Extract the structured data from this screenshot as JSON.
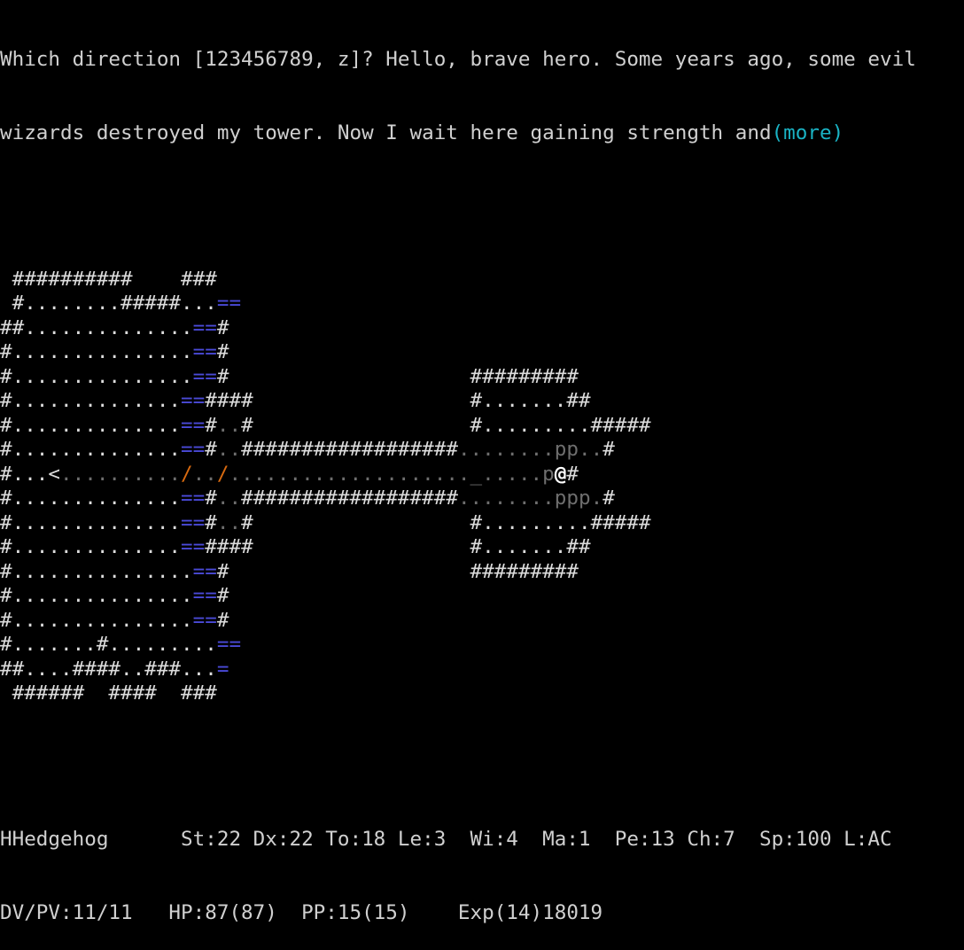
{
  "message": {
    "line1": "Which direction [123456789, z]? Hello, brave hero. Some years ago, some evil",
    "line2": "wizards destroyed my tower. Now I wait here gaining strength and",
    "more": "(more)"
  },
  "map": {
    "legend_colors": {
      "wall": "#dcdcdc",
      "floor_lit": "#dcdcdc",
      "floor_dark": "#6e6e6e",
      "water": "#4a4ad8",
      "door_open": "#d86a10",
      "player": "#ffffff"
    },
    "rows": [
      [
        [
          " ##########    ###",
          "w"
        ]
      ],
      [
        [
          " #........#####...",
          "w"
        ],
        [
          "==",
          "bl"
        ]
      ],
      [
        [
          "##..............",
          "w"
        ],
        [
          "==",
          "bl"
        ],
        [
          "#",
          "w"
        ]
      ],
      [
        [
          "#...............",
          "w"
        ],
        [
          "==",
          "bl"
        ],
        [
          "#",
          "w"
        ]
      ],
      [
        [
          "#...............",
          "w"
        ],
        [
          "==",
          "bl"
        ],
        [
          "#",
          "w"
        ],
        [
          "                    #########",
          "w"
        ]
      ],
      [
        [
          "#..............",
          "w"
        ],
        [
          "==",
          "bl"
        ],
        [
          "####",
          "w"
        ],
        [
          "                  #.......##",
          "w"
        ]
      ],
      [
        [
          "#..............",
          "w"
        ],
        [
          "==",
          "bl"
        ],
        [
          "#",
          "w"
        ],
        [
          "..",
          "dk"
        ],
        [
          "#",
          "w"
        ],
        [
          "                  #.........#####",
          "w"
        ]
      ],
      [
        [
          "#..............",
          "w"
        ],
        [
          "==",
          "bl"
        ],
        [
          "#",
          "w"
        ],
        [
          "..",
          "dk"
        ],
        [
          "##################",
          "w"
        ],
        [
          "........pp..",
          "dk"
        ],
        [
          "#",
          "w"
        ]
      ],
      [
        [
          "#...<",
          "w"
        ],
        [
          "..........",
          "dk"
        ],
        [
          "/",
          "or"
        ],
        [
          "..",
          "dk"
        ],
        [
          "/",
          "or"
        ],
        [
          "...................._.....p",
          "dk"
        ],
        [
          "@",
          "pc"
        ],
        [
          "#",
          "w"
        ]
      ],
      [
        [
          "#..............",
          "w"
        ],
        [
          "==",
          "bl"
        ],
        [
          "#",
          "w"
        ],
        [
          "..",
          "dk"
        ],
        [
          "##################",
          "w"
        ],
        [
          "........ppp.",
          "dk"
        ],
        [
          "#",
          "w"
        ]
      ],
      [
        [
          "#..............",
          "w"
        ],
        [
          "==",
          "bl"
        ],
        [
          "#",
          "w"
        ],
        [
          "..",
          "dk"
        ],
        [
          "#",
          "w"
        ],
        [
          "                  #.........#####",
          "w"
        ]
      ],
      [
        [
          "#..............",
          "w"
        ],
        [
          "==",
          "bl"
        ],
        [
          "####",
          "w"
        ],
        [
          "                  #.......##",
          "w"
        ]
      ],
      [
        [
          "#...............",
          "w"
        ],
        [
          "==",
          "bl"
        ],
        [
          "#",
          "w"
        ],
        [
          "                    #########",
          "w"
        ]
      ],
      [
        [
          "#...............",
          "w"
        ],
        [
          "==",
          "bl"
        ],
        [
          "#",
          "w"
        ]
      ],
      [
        [
          "#...............",
          "w"
        ],
        [
          "==",
          "bl"
        ],
        [
          "#",
          "w"
        ]
      ],
      [
        [
          "#.......#.........",
          "w"
        ],
        [
          "==",
          "bl"
        ]
      ],
      [
        [
          "##....####..###...",
          "w"
        ],
        [
          "=",
          "bl"
        ]
      ],
      [
        [
          " ######  ####  ###",
          "w"
        ]
      ]
    ]
  },
  "status": {
    "line1": "HHedgehog      St:22 Dx:22 To:18 Le:3  Wi:4  Ma:1  Pe:13 Ch:7  Sp:100 L:AC",
    "line2": "DV/PV:11/11   HP:87(87)  PP:15(15)    Exp(14)18019"
  }
}
